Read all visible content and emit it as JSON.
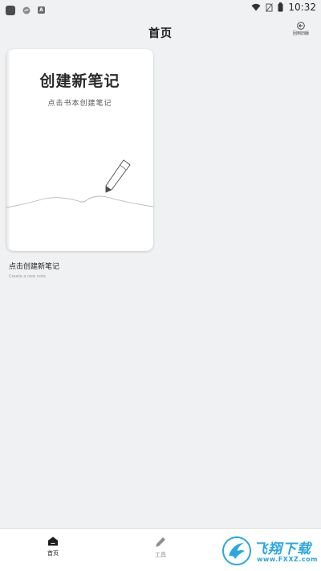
{
  "status_bar": {
    "time": "10:32",
    "notification_icons": [
      "app-square-icon",
      "messenger-icon",
      "a-icon"
    ],
    "system_icons": [
      "wifi-icon",
      "no-sim-icon",
      "battery-icon"
    ]
  },
  "header": {
    "title": "首页",
    "old_version_label": "回到旧版"
  },
  "notebook": {
    "title": "创建新笔记",
    "subtitle": "点击书本创建笔记",
    "label": "点击创建新笔记",
    "sublabel": "Create a new note"
  },
  "bottom_nav": {
    "items": [
      {
        "label": "首页",
        "icon": "home-icon",
        "active": true
      },
      {
        "label": "工具",
        "icon": "pen-icon",
        "active": false
      }
    ]
  },
  "watermark": {
    "text": "飞翔下载",
    "url": "www.FXXZ.com"
  },
  "colors": {
    "background": "#f0f1f3",
    "card": "#ffffff",
    "nav_active": "#1a1a1a",
    "nav_inactive": "#888888",
    "watermark": "#2aa7e0"
  }
}
